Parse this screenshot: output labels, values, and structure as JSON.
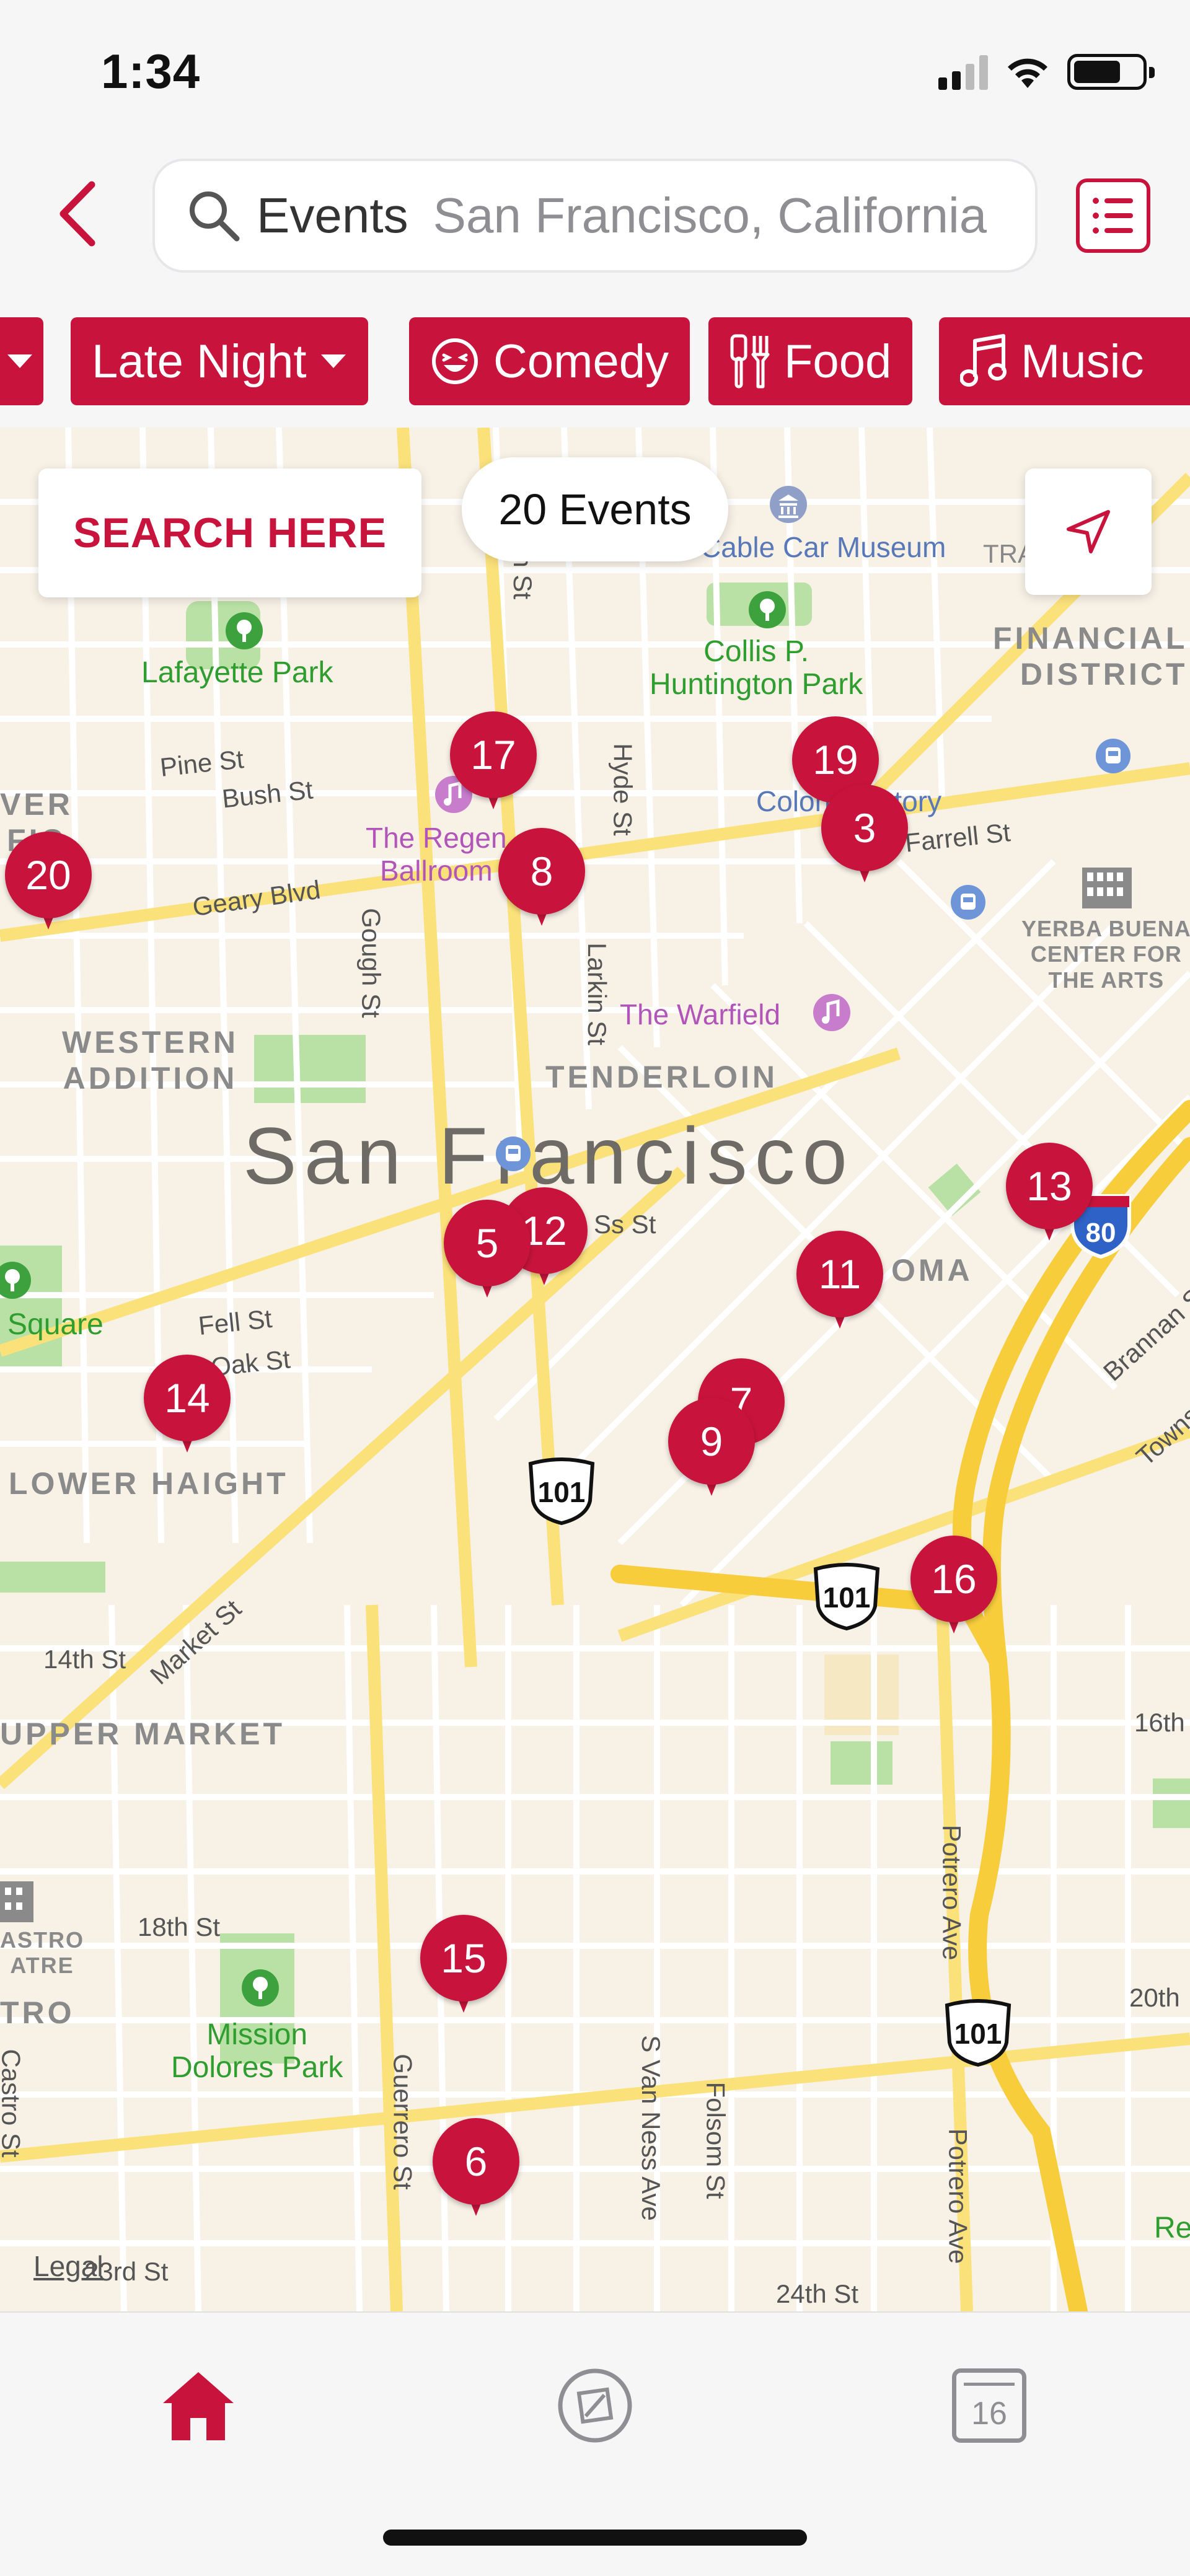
{
  "status_bar": {
    "time": "1:34"
  },
  "header": {
    "search_keyword": "Events",
    "search_location": "San Francisco, California"
  },
  "filters": [
    {
      "label": "",
      "icon": "chevron-down-icon"
    },
    {
      "label": "Late Night",
      "icon": "chevron-down-icon"
    },
    {
      "label": "Comedy",
      "icon": "laughing-face-icon"
    },
    {
      "label": "Food",
      "icon": "fork-knife-icon"
    },
    {
      "label": "Music",
      "icon": "music-note-icon"
    }
  ],
  "map": {
    "search_here_label": "SEARCH HERE",
    "events_count_label": "20 Events",
    "legal_label": "Legal",
    "city_label": "San Francisco",
    "parks": [
      "Lafayette Park",
      "Collis P. Huntington Park",
      "Mission Dolores Park",
      "Square"
    ],
    "districts": [
      "FINANCIAL DISTRICT",
      "WESTERN ADDITION",
      "TENDERLOIN",
      "LOWER HAIGHT",
      "UPPER MARKET",
      "YERBA BUENA CENTER FOR THE ARTS",
      "SOMA",
      "TRO",
      "ATRE",
      "ASTRO",
      "VER",
      "FIC"
    ],
    "streets": [
      "Pine St",
      "Bush St",
      "Geary Blvd",
      "Gough St",
      "Hyde St",
      "Larkin St",
      "Fell St",
      "Oak St",
      "14th St",
      "Market St",
      "18th St",
      "Guerrero St",
      "S Van Ness Ave",
      "Folsom St",
      "Potrero Ave",
      "Brannan St",
      "Townsend",
      "16th",
      "20th",
      "24th St",
      "23rd St",
      "Castro St",
      "Farrell St",
      "In St",
      "Ss St"
    ],
    "pois": [
      "Cable Car Museum",
      "Colony History",
      "The Regency Ballroom",
      "The Warfield",
      "TRA",
      "Re"
    ],
    "highway_shields": [
      "101",
      "101",
      "101",
      "80"
    ],
    "pins": [
      "17",
      "19",
      "3",
      "20",
      "8",
      "13",
      "12",
      "5",
      "11",
      "14",
      "7",
      "9",
      "16",
      "15",
      "6"
    ]
  },
  "tab_bar": {
    "tabs": [
      {
        "name": "home",
        "icon": "home-icon",
        "active": true
      },
      {
        "name": "explore",
        "icon": "compass-icon",
        "active": false
      },
      {
        "name": "calendar",
        "icon": "calendar-icon",
        "label": "16",
        "active": false
      }
    ]
  },
  "colors": {
    "accent": "#c8143c",
    "map_background": "#f7f1e6",
    "highway": "#f7d24a",
    "park": "#b9e0a5"
  }
}
